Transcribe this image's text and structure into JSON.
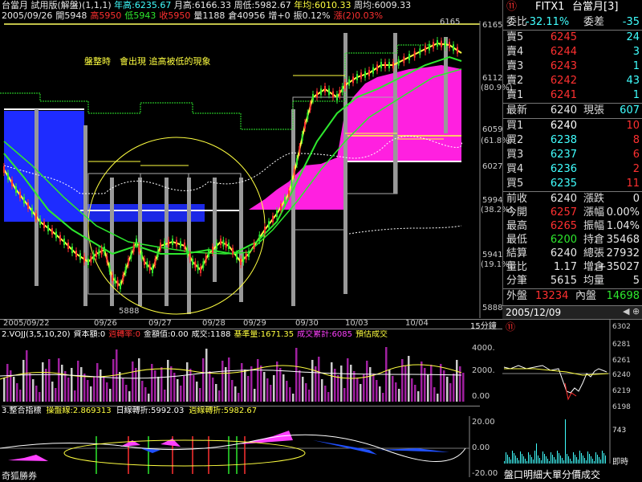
{
  "header": {
    "title_prefix": "台當月",
    "trial": "試用版(解盤)(1,1,1)",
    "year_high_label": "年高:6235.67",
    "month_high_label": "月高:6166.33",
    "week_low_label": "周低:5982.67",
    "year_avg_label": "年均:6010.33",
    "week_avg_label": "周均:6009.33",
    "line2": [
      {
        "t": "2005/09/26",
        "c": "w"
      },
      {
        "t": "開5948",
        "c": "w"
      },
      {
        "t": "高5950",
        "c": "r"
      },
      {
        "t": "低5943",
        "c": "g"
      },
      {
        "t": "收5950",
        "c": "r"
      },
      {
        "t": "量1188",
        "c": "w"
      },
      {
        "t": "倉40956",
        "c": "w"
      },
      {
        "t": "增+0",
        "c": "w"
      },
      {
        "t": "振0.12%",
        "c": "w"
      },
      {
        "t": "漲(2)0.03%",
        "c": "r"
      }
    ]
  },
  "main_chart": {
    "annotation": "盤整時　會出現 追高被低的現象",
    "y_ticks": [
      "6165",
      "6112",
      "6059",
      "6027",
      "5994",
      "5941",
      "5888"
    ],
    "pct_ticks": [
      "(80.9%)",
      "(61.8%)",
      "(38.2%)",
      "(19.1%)"
    ],
    "high_mark": "6165",
    "low_mark": "5888",
    "date_axis": [
      "2005/09/22",
      "09/26",
      "09/27",
      "09/28",
      "09/29",
      "09/30",
      "10/03",
      "10/04"
    ],
    "period": "15分鐘"
  },
  "volume_panel": {
    "title": "2.VOJJ(3,5,10,20)",
    "items": [
      "資本額:0",
      "週轉率:0",
      "金額值:0.00",
      "成交:1188",
      "基準量:1671.35",
      "成交累計:6085",
      "預估成交"
    ],
    "y_ticks": [
      "4000.",
      "2000.",
      "0.00"
    ]
  },
  "indicator_panel": {
    "title": "3.整合指標",
    "items": [
      "操盤線:2.869313",
      "日線轉折:5992.03",
      "週線轉折:5982.67"
    ],
    "y_ticks": [
      "20.00",
      "0.00",
      "-20.00"
    ]
  },
  "footer_left": "奇狐勝券",
  "quote": {
    "symbol": "FITX1",
    "name": "台當月[3]",
    "logo": "⑪",
    "ratio_label": "委比",
    "ratio_value": "-32.11%",
    "diff_label": "委差",
    "diff_value": "-35",
    "asks": [
      {
        "label": "賣5",
        "price": "6245",
        "qty": "24"
      },
      {
        "label": "賣4",
        "price": "6244",
        "qty": "3"
      },
      {
        "label": "賣3",
        "price": "6243",
        "qty": "1"
      },
      {
        "label": "賣2",
        "price": "6242",
        "qty": "43"
      },
      {
        "label": "賣1",
        "price": "6241",
        "qty": "1"
      }
    ],
    "last_label": "最新",
    "last_value": "6240",
    "vol_label": "現張",
    "vol_value": "607",
    "bids": [
      {
        "label": "買1",
        "price": "6240",
        "qty": "10"
      },
      {
        "label": "買2",
        "price": "6238",
        "qty": "8"
      },
      {
        "label": "買3",
        "price": "6237",
        "qty": "6"
      },
      {
        "label": "買4",
        "price": "6236",
        "qty": "2"
      },
      {
        "label": "買5",
        "price": "6235",
        "qty": "11"
      }
    ],
    "stats": [
      {
        "l1": "前收",
        "v1": "6240",
        "c1": "w",
        "l2": "漲跌",
        "v2": "0",
        "c2": "w"
      },
      {
        "l1": "今開",
        "v1": "6257",
        "c1": "r",
        "l2": "漲幅",
        "v2": "0.00%",
        "c2": "w"
      },
      {
        "l1": "最高",
        "v1": "6265",
        "c1": "r",
        "l2": "振幅",
        "v2": "1.04%",
        "c2": "w"
      },
      {
        "l1": "最低",
        "v1": "6200",
        "c1": "g",
        "l2": "持倉",
        "v2": "35468",
        "c2": "w"
      },
      {
        "l1": "結算",
        "v1": "6240",
        "c1": "w",
        "l2": "總張",
        "v2": "27932",
        "c2": "w"
      },
      {
        "l1": "量比",
        "v1": "1.17",
        "c1": "w",
        "l2": "增倉",
        "v2": "+35027",
        "c2": "w"
      },
      {
        "l1": "分筆",
        "v1": "5615",
        "c1": "w",
        "l2": "均量",
        "v2": "5",
        "c2": "w"
      }
    ],
    "outer_label": "外盤",
    "outer_value": "13234",
    "inner_label": "內盤",
    "inner_value": "14698",
    "date": "2005/12/09"
  },
  "mini_chart": {
    "y_ticks": [
      "6302",
      "6281",
      "6261",
      "6240",
      "6219",
      "6198"
    ],
    "vol_tick": "743",
    "time_label": "即時",
    "footer": "盤口明細大單分價成交"
  }
}
